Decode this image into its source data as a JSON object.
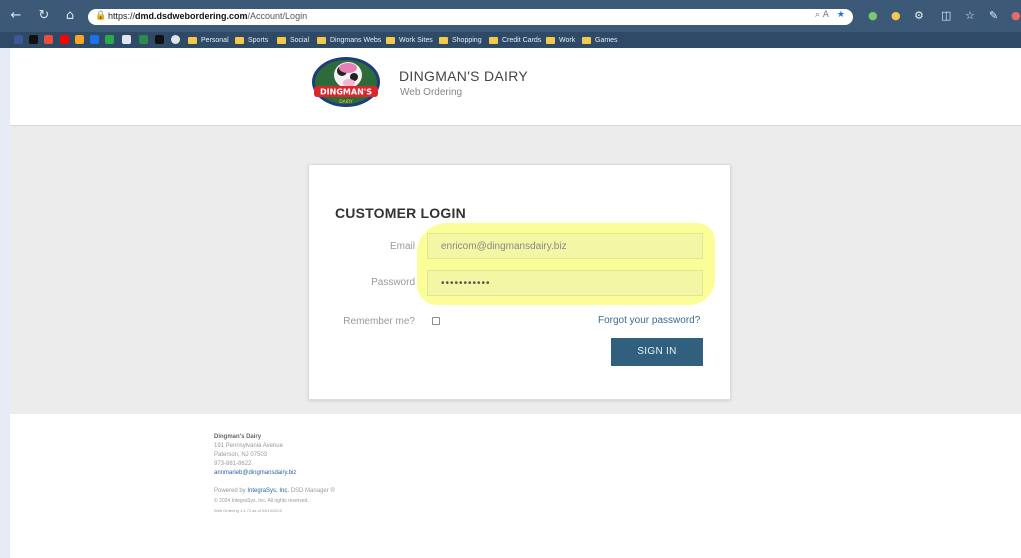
{
  "browser": {
    "url_host": "dmd.dsdwebordering.com",
    "url_prefix": "https://",
    "url_path": "/Account/Login",
    "bookmarks": [
      "Personal",
      "Sports",
      "Social",
      "Dingmans Webs",
      "Work Sites",
      "Shopping",
      "Credit Cards",
      "Work",
      "Games"
    ]
  },
  "header": {
    "logo_text": "DINGMAN'S",
    "logo_sub": "DAIRY",
    "title": "DINGMAN'S DAIRY",
    "subtitle": "Web Ordering"
  },
  "login": {
    "title": "CUSTOMER LOGIN",
    "email_label": "Email",
    "email_value": "enricom@dingmansdairy.biz",
    "password_label": "Password",
    "password_value": "•••••••••••",
    "remember_label": "Remember me?",
    "forgot_link": "Forgot your password?",
    "signin_label": "SIGN IN"
  },
  "footer": {
    "company": "Dingman's Dairy",
    "street": "191 Pennsylvania Avenue",
    "city": "Paterson, NJ 07503",
    "phone": "973-881-8622",
    "email": "annmarieb@dingmansdairy.biz",
    "powered_prefix": "Powered by",
    "powered_brand": "IntegraSys, Inc.",
    "powered_suffix": "DSD Manager ®",
    "copyright": "© 2024 IntegraSys, Inc. All rights reserved.",
    "version": "Web Ordering 1.4.71 as of 03/19/2022"
  },
  "colors": {
    "accent": "#30607e",
    "highlight": "#fbfd93",
    "link": "#3a6b90"
  }
}
